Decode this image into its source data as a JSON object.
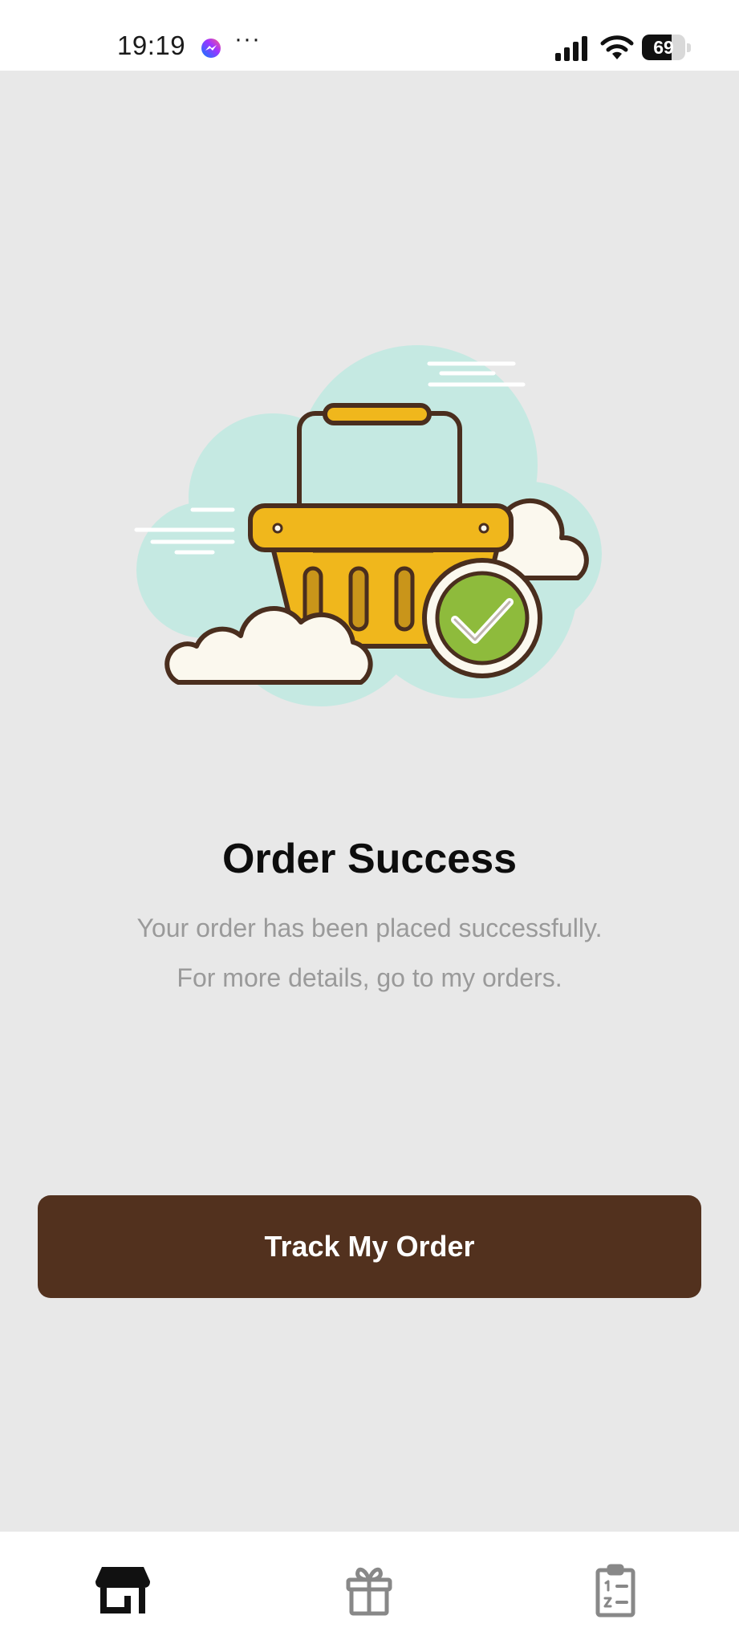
{
  "status_bar": {
    "time": "19:19",
    "more": "···",
    "battery_level": "69",
    "battery_fraction": 0.69,
    "icons": [
      "messenger-icon",
      "signal-icon",
      "wifi-icon",
      "battery-icon"
    ]
  },
  "illustration": {
    "icon": "shopping-basket-check-icon"
  },
  "content": {
    "title": "Order Success",
    "subtitle_line1": "Your order has been placed successfully.",
    "subtitle_line2": "For more details, go to my orders."
  },
  "actions": {
    "track_label": "Track My Order"
  },
  "bottom_nav": {
    "items": [
      {
        "icon": "shop-icon",
        "active": true
      },
      {
        "icon": "gift-icon",
        "active": false
      },
      {
        "icon": "orders-clipboard-icon",
        "active": false
      }
    ]
  },
  "colors": {
    "background": "#e8e8e8",
    "button": "#52311e",
    "title": "#0d0d0d",
    "subtitle": "#9a9a9a",
    "nav_active": "#111111",
    "nav_inactive": "#888888"
  }
}
